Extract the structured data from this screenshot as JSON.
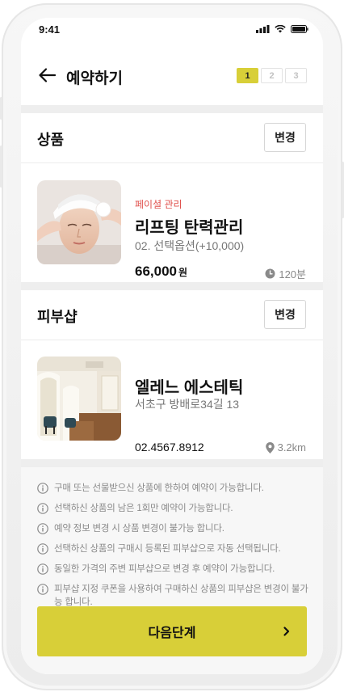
{
  "status": {
    "time": "9:41"
  },
  "header": {
    "title": "예약하기",
    "steps": [
      "1",
      "2",
      "3"
    ],
    "active_step": 1
  },
  "product_section": {
    "title": "상품",
    "change_label": "변경",
    "category": "페이셜 관리",
    "name": "리프팅 탄력관리",
    "option": "02. 선택옵션(+10,000)",
    "price": "66,000",
    "price_unit": "원",
    "duration": "120분"
  },
  "shop_section": {
    "title": "피부샵",
    "change_label": "변경",
    "name": "엘레느 에스테틱",
    "address": "서초구 방배로34길 13",
    "phone": "02.4567.8912",
    "distance": "3.2km"
  },
  "notices": [
    "구매 또는 선물받으신 상품에 한하여 예약이 가능합니다.",
    "선택하신 상품의 남은 1회만 예약이 가능합니다.",
    "예약 정보 변경 시 상품 변경이 불가능 합니다.",
    "선택하신 상품의 구매시 등록된 피부샵으로 자동 선택됩니다.",
    "동일한 가격의 주변 피부샵으로 변경 후 예약이 가능합니다.",
    "피부샵 지정 쿠폰을 사용하여 구매하신 상품의 피부샵은 변경이 불가능 합니다."
  ],
  "footer": {
    "next_label": "다음단계"
  },
  "colors": {
    "accent": "#d8cf38",
    "category": "#e0514d"
  }
}
